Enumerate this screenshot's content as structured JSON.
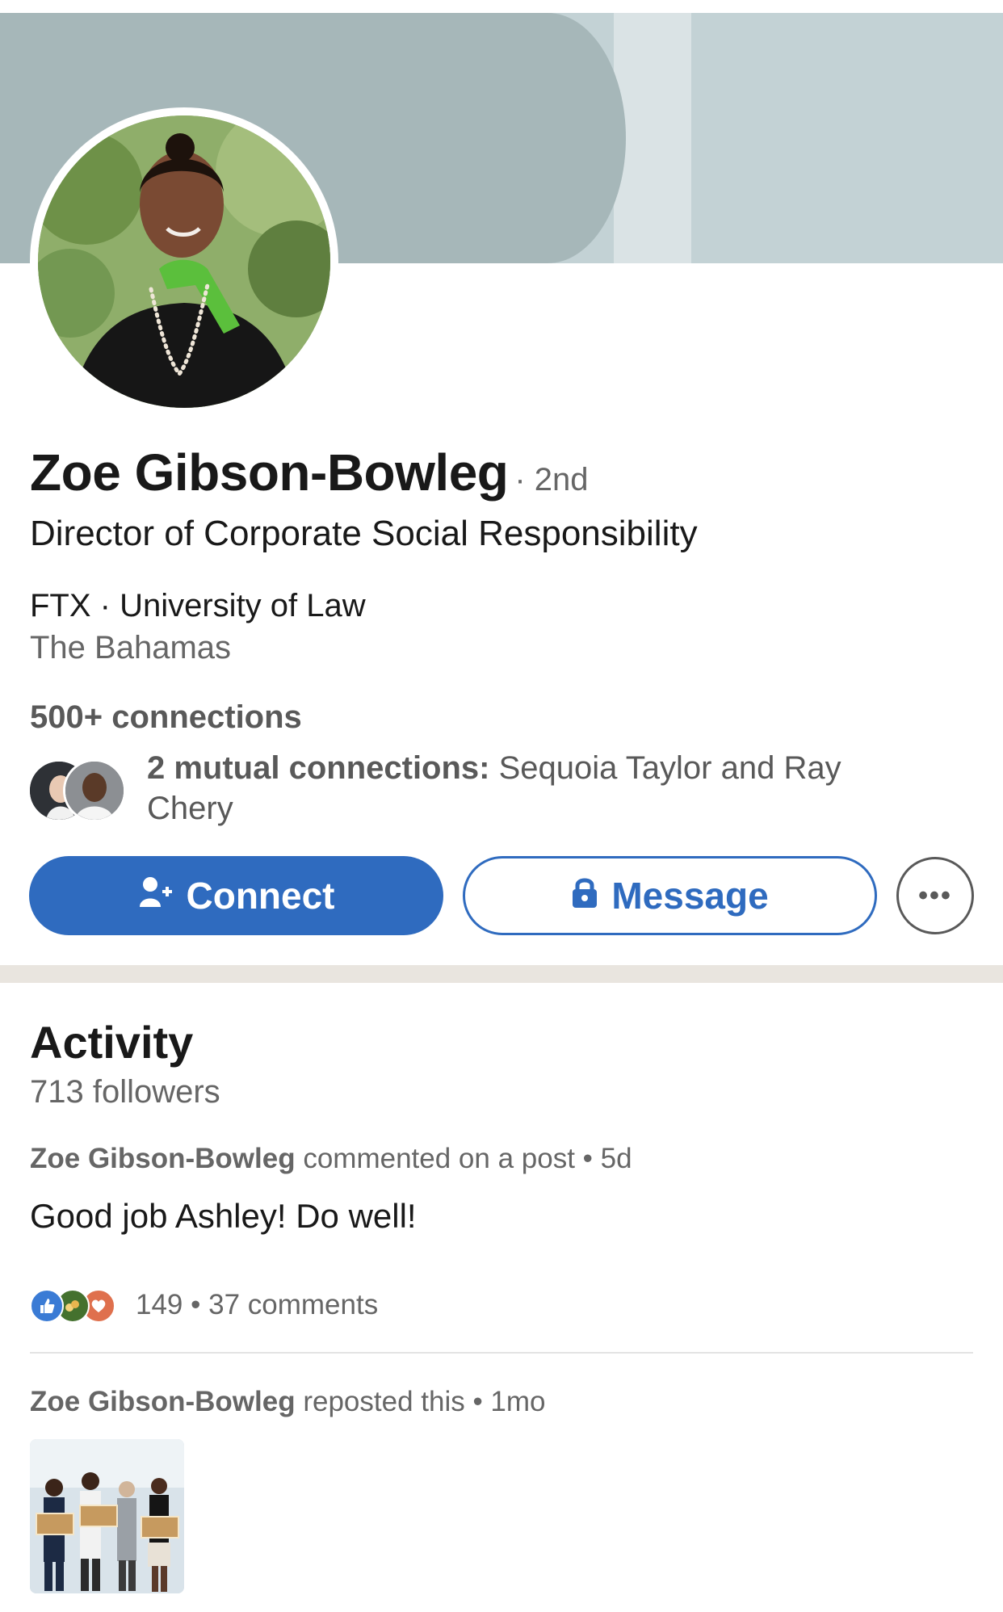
{
  "profile": {
    "name": "Zoe Gibson-Bowleg",
    "degree": "· 2nd",
    "headline": "Director of Corporate Social Responsibility",
    "company_school": "FTX · University of Law",
    "location": "The Bahamas",
    "connections": "500+ connections",
    "mutual_bold": "2 mutual connections:",
    "mutual_rest": " Sequoia Taylor and Ray Chery"
  },
  "actions": {
    "connect_label": "Connect",
    "message_label": "Message",
    "more_label": "•••"
  },
  "activity": {
    "title": "Activity",
    "followers": "713 followers",
    "items": [
      {
        "actor": "Zoe Gibson-Bowleg",
        "action": " commented on a post • 5d",
        "comment": "Good job Ashley! Do well!",
        "reactions_count": "149",
        "comments_text": " • 37 comments"
      },
      {
        "actor": "Zoe Gibson-Bowleg",
        "action": " reposted this • 1mo"
      }
    ]
  },
  "icons": {
    "connect": "person-add-icon",
    "message": "lock-icon",
    "more": "more-horizontal-icon",
    "reactions": [
      "like-icon",
      "celebrate-icon",
      "love-icon"
    ]
  },
  "colors": {
    "accent": "#2f6bbf",
    "banner_primary": "#a6b7b9",
    "banner_secondary": "#c3d2d5",
    "section_divider": "#e9e5df",
    "muted_text": "#666666"
  }
}
